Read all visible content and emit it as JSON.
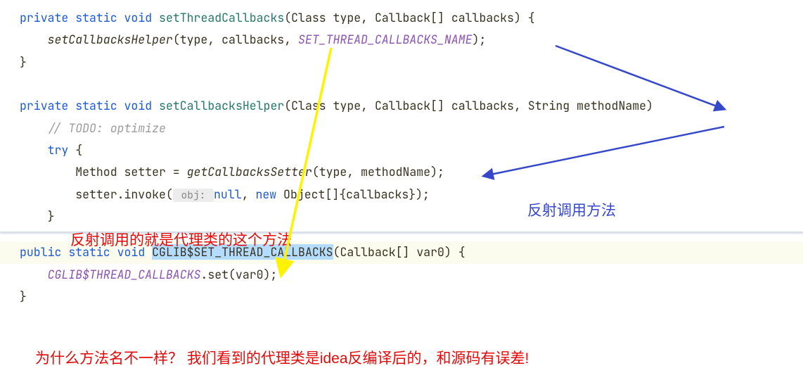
{
  "code": {
    "line1": {
      "kw_private": "private",
      "kw_static": "static",
      "kw_void": "void",
      "method": "setThreadCallbacks",
      "params": "(Class type, Callback[] callbacks) {"
    },
    "line2": {
      "call": "setCallbacksHelper",
      "args_pre": "(type, callbacks, ",
      "const": "SET_THREAD_CALLBACKS_NAME",
      "args_post": ");"
    },
    "line3": "}",
    "line5": {
      "kw_private": "private",
      "kw_static": "static",
      "kw_void": "void",
      "method": "setCallbacksHelper",
      "params": "(Class type, Callback[] callbacks, String methodName) "
    },
    "line6_comment": "// TODO: optimize",
    "line7": {
      "kw_try": "try",
      "brace": " {"
    },
    "line8": {
      "pre": "Method setter = ",
      "call": "getCallbacksSetter",
      "post": "(type, methodName);"
    },
    "line9": {
      "pre": "setter.invoke(",
      "hint": " obj: ",
      "kw_null": "null",
      "mid": ", ",
      "kw_new": "new",
      "post": " Object[]{callbacks});"
    },
    "line10": "}",
    "line12": {
      "kw_public": "public",
      "kw_static": "static",
      "kw_void": "void",
      "hl_method": "CGLIB$SET_THREAD_CALLBACKS",
      "params": "(Callback[] var0) {"
    },
    "line13": {
      "field": "CGLIB$THREAD_CALLBACKS",
      "post": ".set(var0);"
    },
    "line14": "}"
  },
  "annotations": {
    "red1": "反射调用的就是代理类的这个方法",
    "blue1": "反射调用方法",
    "red2": "为什么方法名不一样？ 我们看到的代理类是idea反编译后的，和源码有误差!"
  }
}
